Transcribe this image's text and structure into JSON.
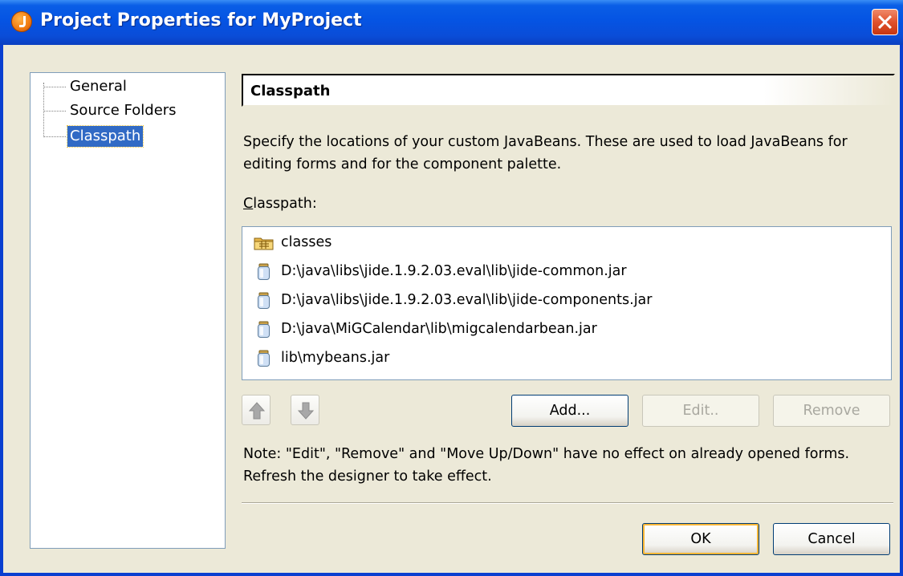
{
  "window": {
    "title": "Project Properties for MyProject"
  },
  "nav": {
    "items": [
      {
        "label": "General",
        "selected": false
      },
      {
        "label": "Source Folders",
        "selected": false
      },
      {
        "label": "Classpath",
        "selected": true
      }
    ]
  },
  "section": {
    "title": "Classpath",
    "description": "Specify the locations of your custom JavaBeans. These are used to load JavaBeans for editing forms and for the component palette.",
    "list_label_mnemonic": "C",
    "list_label_rest": "lasspath:",
    "entries": [
      {
        "icon": "folder-icon",
        "text": "classes"
      },
      {
        "icon": "jar-icon",
        "text": "D:\\java\\libs\\jide.1.9.2.03.eval\\lib\\jide-common.jar"
      },
      {
        "icon": "jar-icon",
        "text": "D:\\java\\libs\\jide.1.9.2.03.eval\\lib\\jide-components.jar"
      },
      {
        "icon": "jar-icon",
        "text": "D:\\java\\MiGCalendar\\lib\\migcalendarbean.jar"
      },
      {
        "icon": "jar-icon",
        "text": "lib\\mybeans.jar"
      }
    ],
    "buttons": {
      "move_up_icon": "arrow-up-icon",
      "move_down_icon": "arrow-down-icon",
      "add": "Add...",
      "edit": "Edit..",
      "remove": "Remove"
    },
    "note": "Note: \"Edit\", \"Remove\" and \"Move Up/Down\" have no effect on already opened forms. Refresh the designer to take effect."
  },
  "footer": {
    "ok": "OK",
    "cancel": "Cancel"
  },
  "colors": {
    "titlebar": "#0554e3",
    "selection": "#316ac5",
    "dialog_bg": "#ece9d8"
  }
}
